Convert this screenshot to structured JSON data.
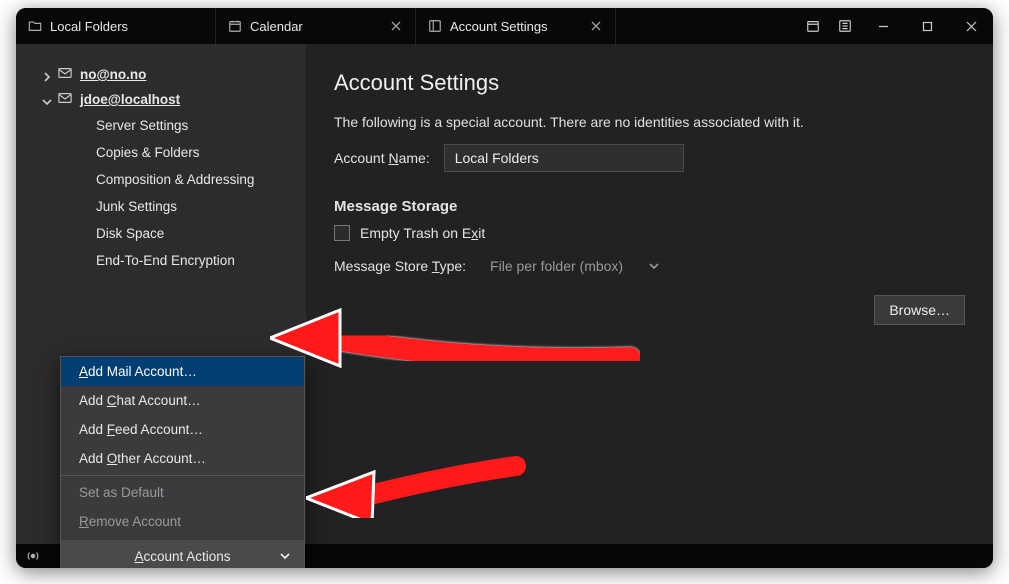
{
  "tabs": [
    {
      "label": "Local Folders",
      "closable": false
    },
    {
      "label": "Calendar",
      "closable": true
    },
    {
      "label": "Account Settings",
      "closable": true
    }
  ],
  "sidebar": {
    "accounts": [
      {
        "label": "no@no.no",
        "expanded": false
      },
      {
        "label": "jdoe@localhost",
        "expanded": true
      }
    ],
    "settings": [
      "Server Settings",
      "Copies & Folders",
      "Composition & Addressing",
      "Junk Settings",
      "Disk Space",
      "End-To-End Encryption"
    ],
    "actions_label": "Account Actions"
  },
  "menu": {
    "add_mail": "Add Mail Account…",
    "add_chat": "Add Chat Account…",
    "add_feed": "Add Feed Account…",
    "add_other": "Add Other Account…",
    "set_default": "Set as Default",
    "remove": "Remove Account"
  },
  "main": {
    "heading": "Account Settings",
    "description": "The following is a special account. There are no identities associated with it.",
    "account_name_label": "Account Name:",
    "account_name_value": "Local Folders",
    "storage_heading": "Message Storage",
    "empty_trash_label": "Empty Trash on Exit",
    "store_type_label": "Message Store Type:",
    "store_type_value": "File per folder (mbox)",
    "browse_label": "Browse…"
  }
}
